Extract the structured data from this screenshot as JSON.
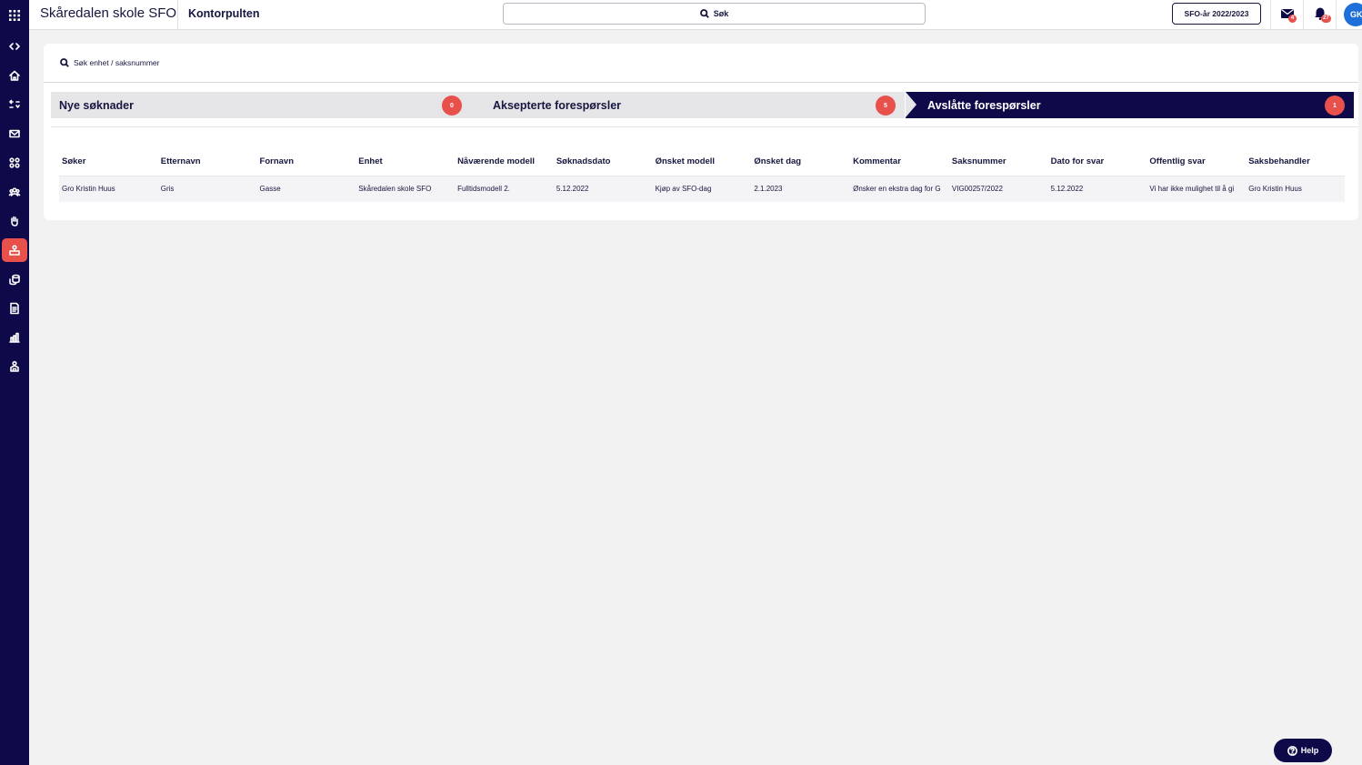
{
  "header": {
    "unit_name": "Skåredalen skole SFO",
    "module_name": "Kontorpulten",
    "search_label": "Søk",
    "school_year_button": "SFO-år 2022/2023",
    "messages_badge": "4",
    "notifications_badge": "27",
    "avatar_initials": "GK"
  },
  "sidebar": {
    "items": [
      {
        "icon": "collapse-icon"
      },
      {
        "icon": "home-icon"
      },
      {
        "icon": "shuffle-icon"
      },
      {
        "icon": "mail-icon"
      },
      {
        "icon": "groups-icon"
      },
      {
        "icon": "people-icon"
      },
      {
        "icon": "hand-icon"
      },
      {
        "icon": "office-desk-icon",
        "active": true
      },
      {
        "icon": "coins-icon"
      },
      {
        "icon": "document-icon"
      },
      {
        "icon": "chart-icon"
      },
      {
        "icon": "admin-icon"
      }
    ]
  },
  "main": {
    "search_placeholder": "Søk enhet / saksnummer",
    "steps": [
      {
        "label": "Nye søknader",
        "count": "0"
      },
      {
        "label": "Aksepterte forespørsler",
        "count": "5"
      },
      {
        "label": "Avslåtte forespørsler",
        "count": "1"
      }
    ],
    "table": {
      "columns": [
        "Søker",
        "Etternavn",
        "Fornavn",
        "Enhet",
        "Nåværende modell",
        "Søknadsdato",
        "Ønsket modell",
        "Ønsket dag",
        "Kommentar",
        "Saksnummer",
        "Dato for svar",
        "Offentlig svar",
        "Saksbehandler"
      ],
      "rows": [
        [
          "Gro Kristin Huus",
          "Gris",
          "Gasse",
          "Skåredalen skole SFO",
          "Fulltidsmodell 2.",
          "5.12.2022",
          "Kjøp av SFO-dag",
          "2.1.2023",
          "Ønsker en ekstra dag for G",
          "VIG00257/2022",
          "5.12.2022",
          "Vi har ikke mulighet til å gi",
          "Gro Kristin Huus"
        ]
      ]
    }
  },
  "help_button": "Help",
  "colors": {
    "navy": "#0e0a4a",
    "accent_red": "#e8504b",
    "avatar_blue": "#1f6fd8"
  }
}
